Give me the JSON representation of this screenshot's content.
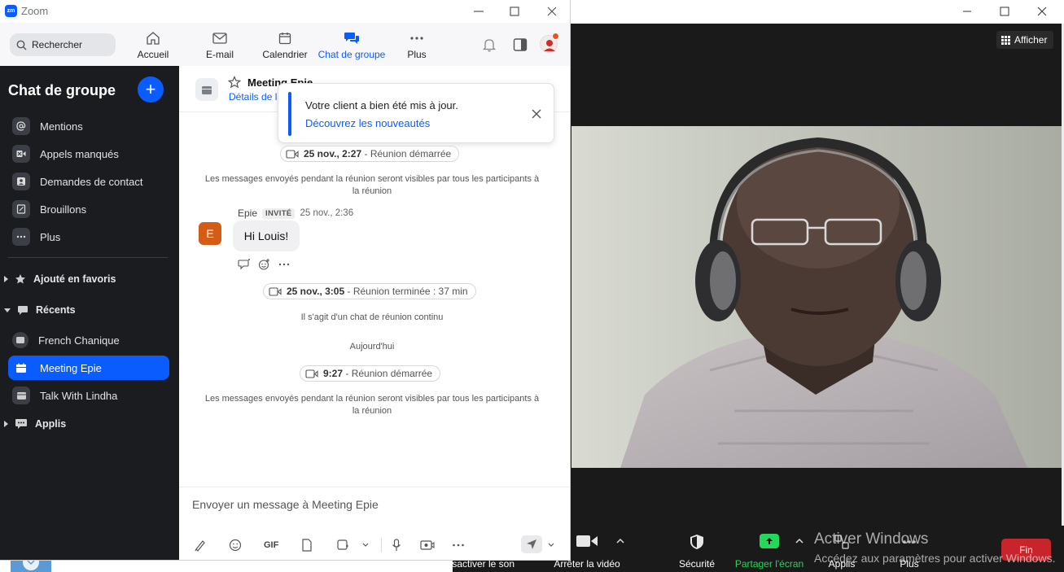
{
  "zoom_window": {
    "title": "Zoom",
    "logo_text": "zm",
    "search_placeholder": "Rechercher",
    "nav_tabs": [
      {
        "label": "Accueil",
        "icon": "home-icon"
      },
      {
        "label": "E-mail",
        "icon": "mail-icon"
      },
      {
        "label": "Calendrier",
        "icon": "calendar-icon"
      },
      {
        "label": "Chat de groupe",
        "icon": "chat-icon",
        "active": true
      },
      {
        "label": "Plus",
        "icon": "more-icon"
      }
    ],
    "accent_color": "#0b5cff"
  },
  "sidebar": {
    "title": "Chat de groupe",
    "add_label": "+",
    "items": [
      {
        "label": "Mentions",
        "icon": "at-icon"
      },
      {
        "label": "Appels manqués",
        "icon": "missed-video-icon"
      },
      {
        "label": "Demandes de contact",
        "icon": "contact-icon"
      },
      {
        "label": "Brouillons",
        "icon": "draft-icon"
      },
      {
        "label": "Plus",
        "icon": "more-icon"
      }
    ],
    "sections": {
      "favorites": "Ajouté en favoris",
      "recents": "Récents",
      "apps": "Applis"
    },
    "recents": [
      {
        "label": "French Chanique",
        "active": false
      },
      {
        "label": "Meeting Epie",
        "active": true
      },
      {
        "label": "Talk With Lindha",
        "active": false
      }
    ]
  },
  "chat": {
    "name": "Meeting Epie",
    "details_link": "Détails de la",
    "notification": {
      "message": "Votre client a bien été mis à jour.",
      "link": "Découvrez les nouveautés"
    },
    "pill1": {
      "time": "25 nov., 2:27",
      "text": " - Réunion démarrée"
    },
    "system_message": "Les messages envoyés pendant la réunion seront visibles par tous les participants à la réunion",
    "message": {
      "avatar_letter": "E",
      "sender": "Epie",
      "badge": "INVITÉ",
      "time": "25 nov., 2:36",
      "text": "Hi Louis!"
    },
    "pill2": {
      "time": "25 nov., 3:05",
      "text": " - Réunion terminée : 37 min"
    },
    "continuous_note": "Il s'agit d'un chat de réunion continu",
    "today_label": "Aujourd'hui",
    "pill3": {
      "time": "9:27",
      "text": " - Réunion démarrée"
    },
    "system_message_2": "Les messages envoyés pendant la réunion seront visibles par tous les participants à la réunion",
    "compose_placeholder": "Envoyer un message à Meeting Epie",
    "gif_label": "GIF"
  },
  "meeting": {
    "afficher_label": "Afficher",
    "toolbar": {
      "mute_label": "Désactiver le son",
      "video_label": "Arrêter la vidéo",
      "security_label": "Sécurité",
      "share_label": "Partager l'écran",
      "apps_label": "Applis",
      "more_label": "Plus",
      "end_label": "Fin"
    },
    "share_color": "#23d959",
    "end_color": "#c8242b"
  },
  "watermark": {
    "line1": "Activer Windows",
    "line2": "Accédez aux paramètres pour activer Windows."
  }
}
